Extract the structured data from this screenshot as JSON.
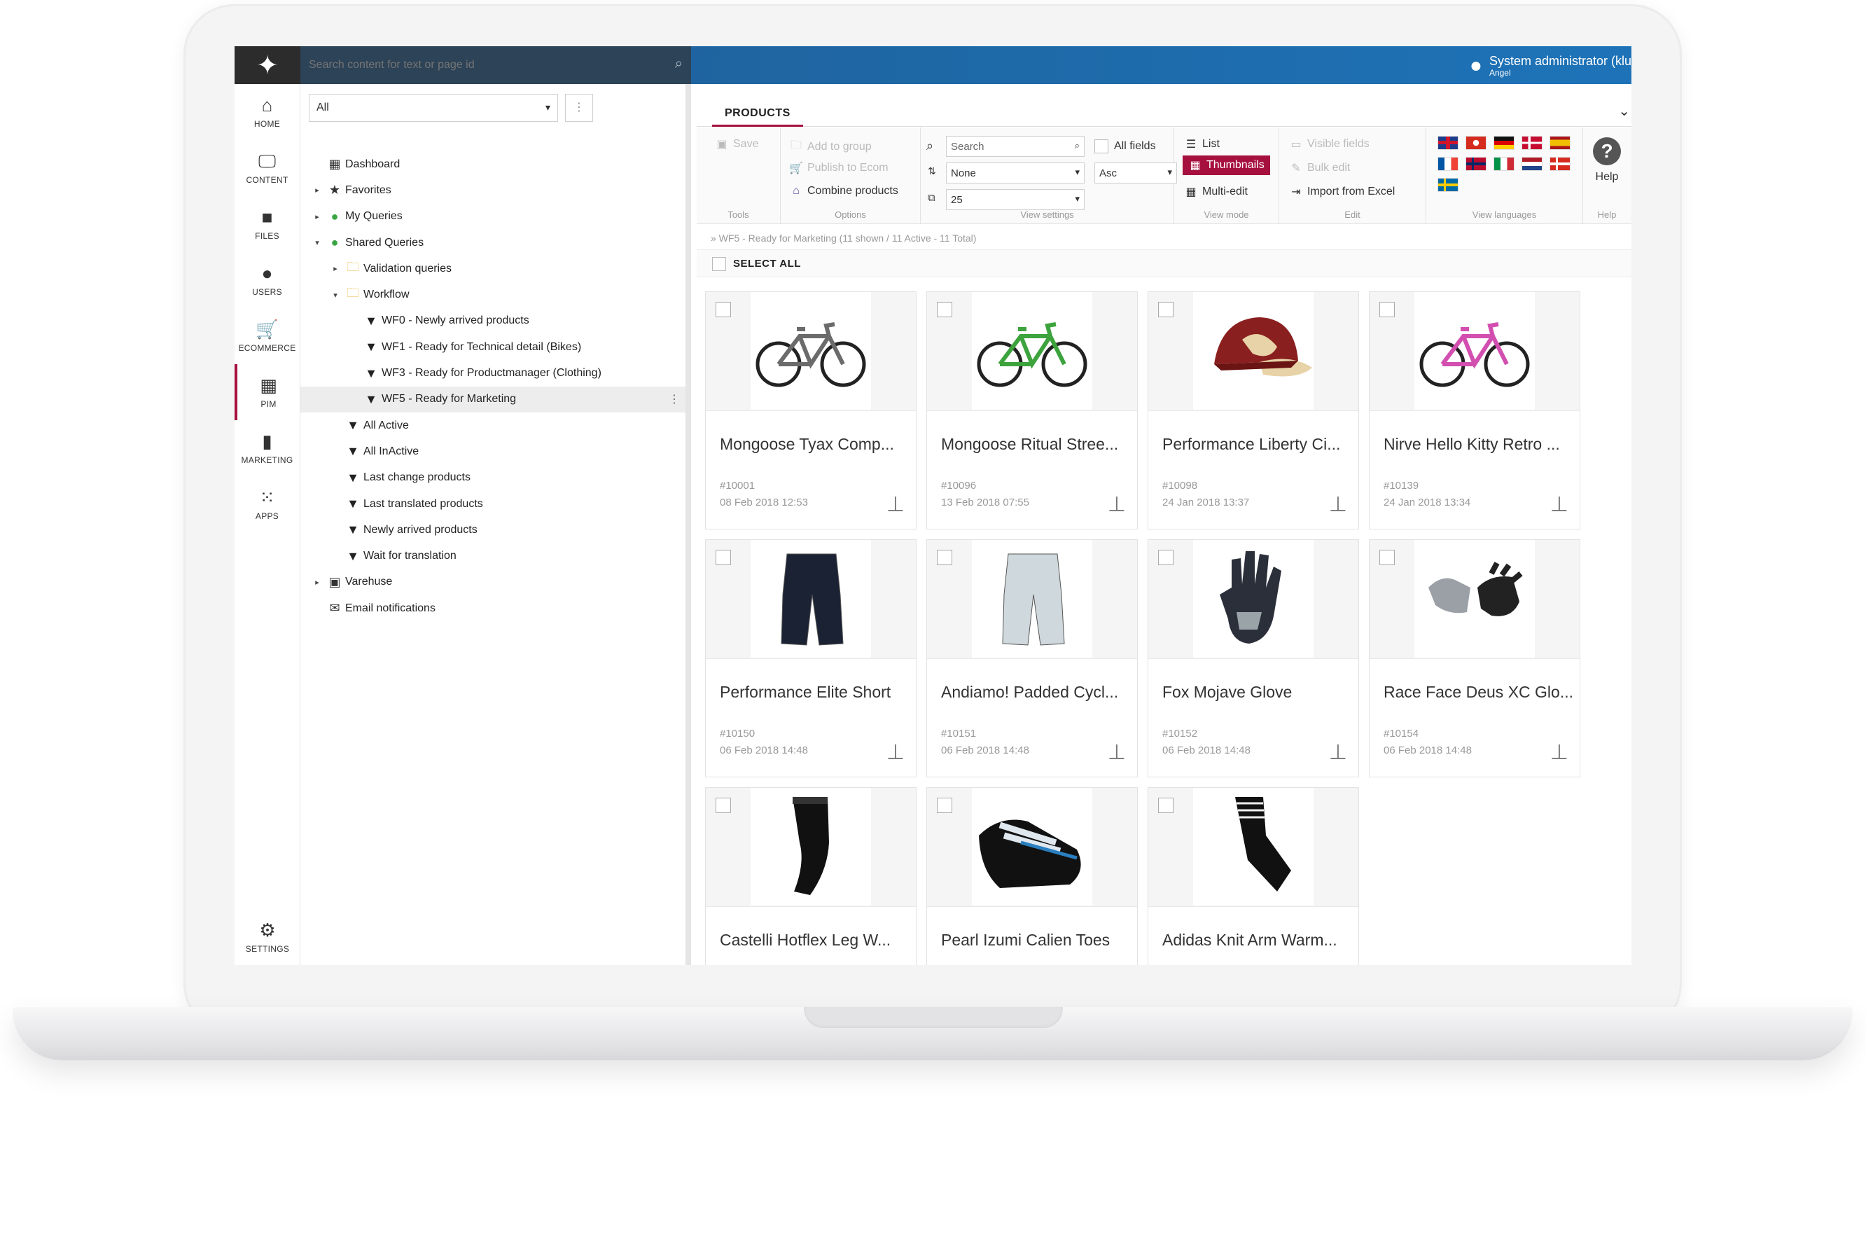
{
  "app": {
    "search_placeholder": "Search content for text or page id",
    "user_name": "System administrator (klu",
    "user_sub": "Angel"
  },
  "nav": [
    {
      "label": "HOME",
      "icon": "home-icon",
      "glyph": "⌂"
    },
    {
      "label": "CONTENT",
      "icon": "monitor-icon",
      "glyph": "🖵"
    },
    {
      "label": "FILES",
      "icon": "briefcase-icon",
      "glyph": "■"
    },
    {
      "label": "USERS",
      "icon": "user-icon",
      "glyph": "●"
    },
    {
      "label": "ECOMMERCE",
      "icon": "cart-icon",
      "glyph": "🛒"
    },
    {
      "label": "PIM",
      "icon": "building-icon",
      "glyph": "▦"
    },
    {
      "label": "MARKETING",
      "icon": "bar-chart-icon",
      "glyph": "▮"
    },
    {
      "label": "APPS",
      "icon": "apps-grid-icon",
      "glyph": "⁙"
    }
  ],
  "nav_settings": {
    "label": "SETTINGS",
    "glyph": "⚙"
  },
  "tree": {
    "filter_value": "All",
    "menu_glyph": "⋮",
    "items": [
      {
        "label": "Dashboard",
        "indent": 0,
        "twisty": "",
        "glyph": "▦",
        "color": "#333"
      },
      {
        "label": "Favorites",
        "indent": 0,
        "twisty": "▸",
        "glyph": "★",
        "color": "#333"
      },
      {
        "label": "My Queries",
        "indent": 0,
        "twisty": "▸",
        "glyph": "●",
        "color": "#3aa543"
      },
      {
        "label": "Shared Queries",
        "indent": 0,
        "twisty": "▾",
        "glyph": "●",
        "color": "#3aa543"
      },
      {
        "label": "Validation queries",
        "indent": 1,
        "twisty": "▸",
        "glyph": "🗀",
        "color": "#e8b84a"
      },
      {
        "label": "Workflow",
        "indent": 1,
        "twisty": "▾",
        "glyph": "🗀",
        "color": "#e8b84a"
      },
      {
        "label": "WF0 - Newly arrived products",
        "indent": 2,
        "twisty": "",
        "glyph": "▼",
        "color": "#222"
      },
      {
        "label": "WF1 - Ready for Technical detail (Bikes)",
        "indent": 2,
        "twisty": "",
        "glyph": "▼",
        "color": "#222"
      },
      {
        "label": "WF3 - Ready for Productmanager (Clothing)",
        "indent": 2,
        "twisty": "",
        "glyph": "▼",
        "color": "#222"
      },
      {
        "label": "WF5 - Ready for Marketing",
        "indent": 2,
        "twisty": "",
        "glyph": "▼",
        "color": "#222",
        "selected": true
      },
      {
        "label": "All Active",
        "indent": 1,
        "twisty": "",
        "glyph": "▼",
        "color": "#222"
      },
      {
        "label": "All InActive",
        "indent": 1,
        "twisty": "",
        "glyph": "▼",
        "color": "#222"
      },
      {
        "label": "Last change products",
        "indent": 1,
        "twisty": "",
        "glyph": "▼",
        "color": "#222"
      },
      {
        "label": "Last translated products",
        "indent": 1,
        "twisty": "",
        "glyph": "▼",
        "color": "#222"
      },
      {
        "label": "Newly arrived products",
        "indent": 1,
        "twisty": "",
        "glyph": "▼",
        "color": "#222"
      },
      {
        "label": "Wait for translation",
        "indent": 1,
        "twisty": "",
        "glyph": "▼",
        "color": "#222"
      },
      {
        "label": "Varehuse",
        "indent": 0,
        "twisty": "▸",
        "glyph": "▣",
        "color": "#333"
      },
      {
        "label": "Email notifications",
        "indent": 0,
        "twisty": "",
        "glyph": "✉",
        "color": "#333"
      }
    ]
  },
  "main": {
    "tab_label": "PRODUCTS",
    "ribbon": {
      "tools": {
        "caption": "Tools",
        "save": "Save"
      },
      "options": {
        "caption": "Options",
        "add_to_group": "Add to group",
        "publish": "Publish to Ecom",
        "combine": "Combine products"
      },
      "view_settings": {
        "caption": "View settings",
        "search_placeholder": "Search",
        "all_fields": "All fields",
        "sort_field": "None",
        "sort_dir": "Asc",
        "page_size": "25"
      },
      "view_mode": {
        "caption": "View mode",
        "list": "List",
        "thumbnails": "Thumbnails",
        "multi_edit": "Multi-edit"
      },
      "edit": {
        "caption": "Edit",
        "visible_fields": "Visible fields",
        "bulk_edit": "Bulk edit",
        "import_excel": "Import from Excel"
      },
      "languages": {
        "caption": "View languages"
      },
      "help": {
        "caption": "Help",
        "label": "Help"
      }
    },
    "breadcrumb": "» WF5 - Ready for Marketing (11 shown / 11 Active - 11 Total)",
    "select_all": "SELECT ALL",
    "products": [
      {
        "title": "Mongoose Tyax Comp...",
        "id": "#10001",
        "date": "08 Feb 2018 12:53",
        "kind": "bike",
        "color": "#6b6b6b"
      },
      {
        "title": "Mongoose Ritual Stree...",
        "id": "#10096",
        "date": "13 Feb 2018 07:55",
        "kind": "bike",
        "color": "#3da33d"
      },
      {
        "title": "Performance Liberty Ci...",
        "id": "#10098",
        "date": "24 Jan 2018 13:37",
        "kind": "cap",
        "color": "#8a1f1f"
      },
      {
        "title": "Nirve Hello Kitty Retro ...",
        "id": "#10139",
        "date": "24 Jan 2018 13:34",
        "kind": "bike",
        "color": "#d24fb0"
      },
      {
        "title": "Performance Elite Short",
        "id": "#10150",
        "date": "06 Feb 2018 14:48",
        "kind": "short",
        "color": "#1a2233"
      },
      {
        "title": "Andiamo! Padded Cycl...",
        "id": "#10151",
        "date": "06 Feb 2018 14:48",
        "kind": "short",
        "color": "#cfd8dc"
      },
      {
        "title": "Fox Mojave Glove",
        "id": "#10152",
        "date": "06 Feb 2018 14:48",
        "kind": "glove",
        "color": "#2a2f3a"
      },
      {
        "title": "Race Face Deus XC Glo...",
        "id": "#10154",
        "date": "06 Feb 2018 14:48",
        "kind": "gloves",
        "color": "#222"
      },
      {
        "title": "Castelli Hotflex Leg W...",
        "id": "",
        "date": "",
        "kind": "leg",
        "color": "#111"
      },
      {
        "title": "Pearl Izumi Calien Toes",
        "id": "",
        "date": "",
        "kind": "shoe",
        "color": "#111"
      },
      {
        "title": "Adidas Knit Arm Warm...",
        "id": "",
        "date": "",
        "kind": "arm",
        "color": "#111"
      }
    ]
  }
}
